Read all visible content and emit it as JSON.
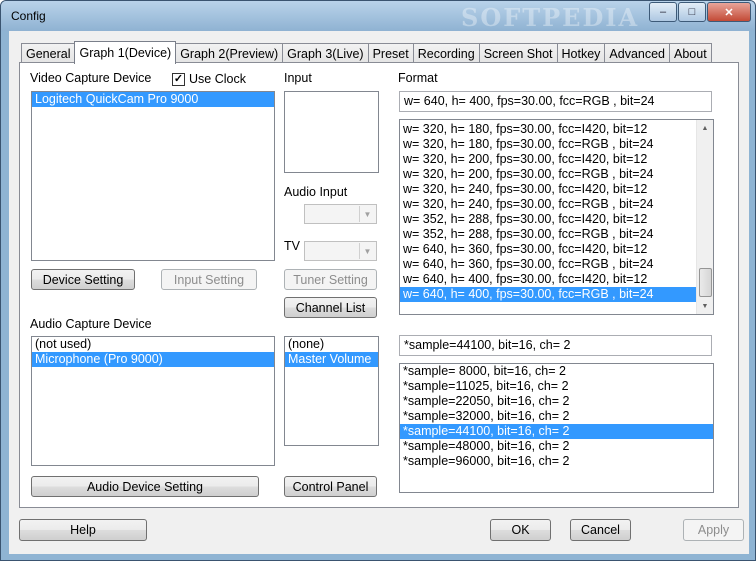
{
  "window": {
    "title": "Config",
    "watermark": "SOFTPEDIA"
  },
  "titlebar_buttons": {
    "minimize": "–",
    "maximize": "□",
    "close": "✕"
  },
  "tabs": [
    {
      "label": "General"
    },
    {
      "label": "Graph 1(Device)",
      "active": true
    },
    {
      "label": "Graph 2(Preview)"
    },
    {
      "label": "Graph 3(Live)"
    },
    {
      "label": "Preset"
    },
    {
      "label": "Recording"
    },
    {
      "label": "Screen Shot"
    },
    {
      "label": "Hotkey"
    },
    {
      "label": "Advanced"
    },
    {
      "label": "About"
    }
  ],
  "video": {
    "label": "Video Capture Device",
    "use_clock_label": "Use Clock",
    "use_clock_checked": true,
    "devices": [
      "Logitech QuickCam Pro 9000"
    ],
    "selected_index": 0,
    "device_setting_button": "Device Setting",
    "input_setting_button": "Input Setting"
  },
  "input": {
    "label": "Input",
    "audio_input_label": "Audio Input",
    "tv_label": "TV",
    "tuner_setting_button": "Tuner Setting",
    "channel_list_button": "Channel List"
  },
  "format": {
    "label": "Format",
    "current": "w= 640, h= 400, fps=30.00,  fcc=RGB , bit=24",
    "options": [
      "w= 320, h= 180, fps=30.00,  fcc=I420, bit=12",
      "w= 320, h= 180, fps=30.00,  fcc=RGB , bit=24",
      "w= 320, h= 200, fps=30.00,  fcc=I420, bit=12",
      "w= 320, h= 200, fps=30.00,  fcc=RGB , bit=24",
      "w= 320, h= 240, fps=30.00,  fcc=I420, bit=12",
      "w= 320, h= 240, fps=30.00,  fcc=RGB , bit=24",
      "w= 352, h= 288, fps=30.00,  fcc=I420, bit=12",
      "w= 352, h= 288, fps=30.00,  fcc=RGB , bit=24",
      "w= 640, h= 360, fps=30.00,  fcc=I420, bit=12",
      "w= 640, h= 360, fps=30.00,  fcc=RGB , bit=24",
      "w= 640, h= 400, fps=30.00,  fcc=I420, bit=12",
      "w= 640, h= 400, fps=30.00,  fcc=RGB , bit=24"
    ],
    "selected_index": 11
  },
  "audio": {
    "label": "Audio Capture Device",
    "devices": [
      "(not used)",
      "Microphone (Pro 9000)"
    ],
    "selected_index": 1,
    "inputs": [
      "(none)",
      "Master Volume"
    ],
    "input_selected_index": 1,
    "audio_device_setting_button": "Audio Device Setting",
    "control_panel_button": "Control Panel",
    "current_format": "*sample=44100, bit=16, ch= 2",
    "formats": [
      "*sample= 8000, bit=16, ch= 2",
      "*sample=11025, bit=16, ch= 2",
      "*sample=22050, bit=16, ch= 2",
      "*sample=32000, bit=16, ch= 2",
      "*sample=44100, bit=16, ch= 2",
      "*sample=48000, bit=16, ch= 2",
      "*sample=96000, bit=16, ch= 2"
    ],
    "format_selected_index": 4
  },
  "footer": {
    "help": "Help",
    "ok": "OK",
    "cancel": "Cancel",
    "apply": "Apply"
  },
  "colors": {
    "selection": "#3399ff",
    "titlebar": "#8fb4d3"
  }
}
